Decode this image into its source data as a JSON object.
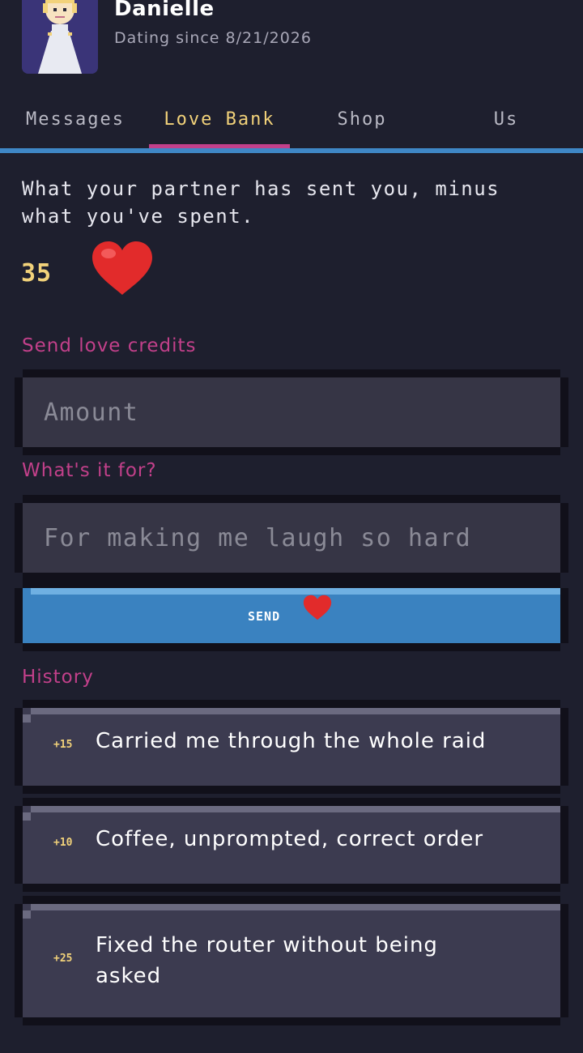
{
  "header": {
    "name": "Danielle",
    "subtitle": "Dating since 8/21/2026"
  },
  "tabs": [
    {
      "label": "Messages",
      "active": false
    },
    {
      "label": "Love Bank",
      "active": true
    },
    {
      "label": "Shop",
      "active": false
    },
    {
      "label": "Us",
      "active": false
    }
  ],
  "bank": {
    "intro": "What your partner has sent you, minus what you've spent.",
    "balance": "35",
    "balance_icon": "heart-icon"
  },
  "send_form": {
    "label": "Send love credits",
    "amount_placeholder": "Amount",
    "reason_label": "What's it for?",
    "reason_placeholder": "For making me laugh so hard",
    "send_label": "SEND",
    "send_icon": "heart-icon"
  },
  "history": {
    "label": "History",
    "items": [
      {
        "amount": "+15",
        "text": "Carried me through the whole raid"
      },
      {
        "amount": "+10",
        "text": "Coffee, unprompted, correct order"
      },
      {
        "amount": "+25",
        "text": "Fixed the router without being asked"
      }
    ]
  },
  "colors": {
    "background": "#1e1f2e",
    "accent_pink": "#c2408a",
    "accent_gold": "#f2d27a",
    "accent_blue": "#3a82c0"
  }
}
